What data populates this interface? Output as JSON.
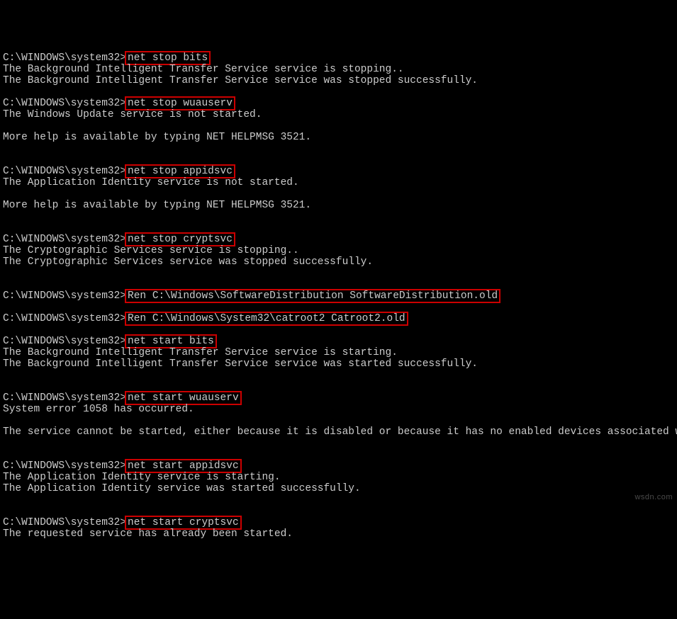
{
  "prompt": "C:\\WINDOWS\\system32>",
  "blocks": [
    {
      "cmd": "net stop bits",
      "out": [
        "The Background Intelligent Transfer Service service is stopping..",
        "The Background Intelligent Transfer Service service was stopped successfully.",
        ""
      ]
    },
    {
      "cmd": "net stop wuauserv",
      "out": [
        "The Windows Update service is not started.",
        "",
        "More help is available by typing NET HELPMSG 3521.",
        "",
        ""
      ]
    },
    {
      "cmd": "net stop appidsvc",
      "out": [
        "The Application Identity service is not started.",
        "",
        "More help is available by typing NET HELPMSG 3521.",
        "",
        ""
      ]
    },
    {
      "cmd": "net stop cryptsvc",
      "out": [
        "The Cryptographic Services service is stopping..",
        "The Cryptographic Services service was stopped successfully.",
        "",
        ""
      ]
    },
    {
      "cmd": "Ren C:\\Windows\\SoftwareDistribution SoftwareDistribution.old",
      "out": [
        ""
      ]
    },
    {
      "cmd": "Ren C:\\Windows\\System32\\catroot2 Catroot2.old",
      "out": [
        ""
      ]
    },
    {
      "cmd": "net start bits",
      "out": [
        "The Background Intelligent Transfer Service service is starting.",
        "The Background Intelligent Transfer Service service was started successfully.",
        "",
        ""
      ]
    },
    {
      "cmd": "net start wuauserv",
      "out": [
        "System error 1058 has occurred.",
        "",
        "The service cannot be started, either because it is disabled or because it has no enabled devices associated with it.",
        "",
        ""
      ]
    },
    {
      "cmd": "net start appidsvc",
      "out": [
        "The Application Identity service is starting.",
        "The Application Identity service was started successfully.",
        "",
        ""
      ]
    },
    {
      "cmd": "net start cryptsvc",
      "out": [
        "The requested service has already been started."
      ]
    }
  ],
  "watermark": "wsdn.com"
}
